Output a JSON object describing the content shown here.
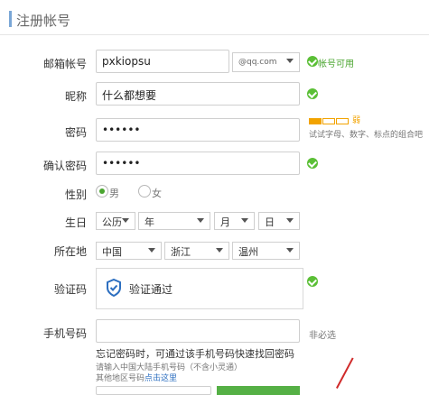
{
  "header": {
    "title": "注册帐号"
  },
  "form": {
    "email": {
      "label": "邮箱帐号",
      "value": "pxkiopsu",
      "domain": "@qq.com",
      "status": "帐号可用"
    },
    "nickname": {
      "label": "昵称",
      "value": "什么都想要"
    },
    "password": {
      "label": "密码",
      "value": "••••••",
      "hint": "试试字母、数字、标点的组合吧",
      "strength_label": "弱"
    },
    "confirm_password": {
      "label": "确认密码",
      "value": "••••••"
    },
    "gender": {
      "label": "性别",
      "options": [
        {
          "label": "男",
          "checked": true
        },
        {
          "label": "女",
          "checked": false
        }
      ]
    },
    "birthday": {
      "label": "生日",
      "calendar": "公历",
      "year": "年",
      "month": "月",
      "day": "日"
    },
    "location": {
      "label": "所在地",
      "country": "中国",
      "province": "浙江",
      "city": "温州"
    },
    "captcha": {
      "label": "验证码",
      "status": "验证通过"
    },
    "phone": {
      "label": "手机号码",
      "value": "",
      "optional": "非必选",
      "tip": "忘记密码时，可通过该手机号码快速找回密码",
      "note1": "请输入中国大陆手机号码（不含小灵通）",
      "note2": "其他地区号码",
      "note2_link": "点击这里"
    }
  },
  "colors": {
    "accent": "#4aa52f",
    "border": "#cfcfcf",
    "link": "#2d6fc0",
    "warning": "#f2a300"
  }
}
